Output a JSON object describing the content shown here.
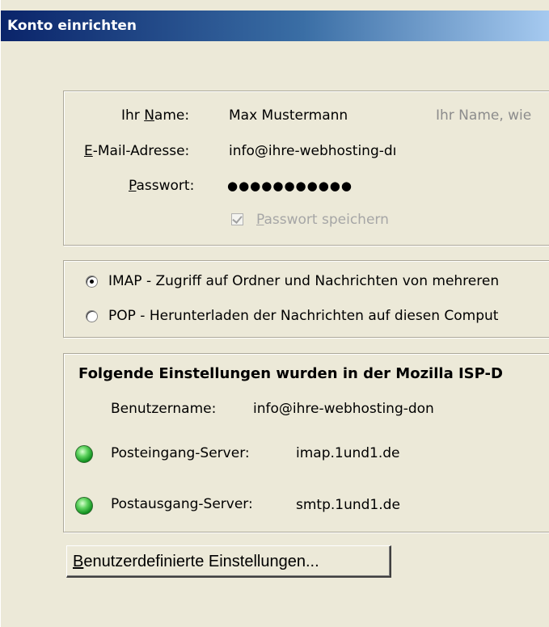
{
  "window": {
    "title": "Konto einrichten"
  },
  "account": {
    "name_label_pre": "Ihr ",
    "name_label_key": "N",
    "name_label_post": "ame:",
    "name_value": "Max Mustermann",
    "name_hint": "Ihr Name, wie",
    "email_label_key": "E",
    "email_label_post": "-Mail-Adresse:",
    "email_value": "info@ihre-webhosting-dı",
    "password_label_key": "P",
    "password_label_post": "asswort:",
    "password_mask": "●●●●●●●●●●●",
    "save_password_key": "P",
    "save_password_post": "asswort speichern",
    "save_password_checked": true
  },
  "protocol": {
    "selected": "imap",
    "imap_label": "IMAP - Zugriff auf Ordner und Nachrichten von mehreren",
    "pop_label": "POP - Herunterladen der Nachrichten auf diesen Comput"
  },
  "settings": {
    "heading": "Folgende Einstellungen wurden in der Mozilla ISP-D",
    "username_label": "Benutzername:",
    "username_value": "info@ihre-webhosting-don",
    "incoming_label": "Posteingang-Server:",
    "incoming_value": "imap.1und1.de",
    "incoming_status_color": "#2eb82e",
    "outgoing_label": "Postausgang-Server:",
    "outgoing_value": "smtp.1und1.de",
    "outgoing_status_color": "#2eb82e"
  },
  "buttons": {
    "advanced_key": "B",
    "advanced_post": "enutzerdefinierte Einstellungen..."
  }
}
